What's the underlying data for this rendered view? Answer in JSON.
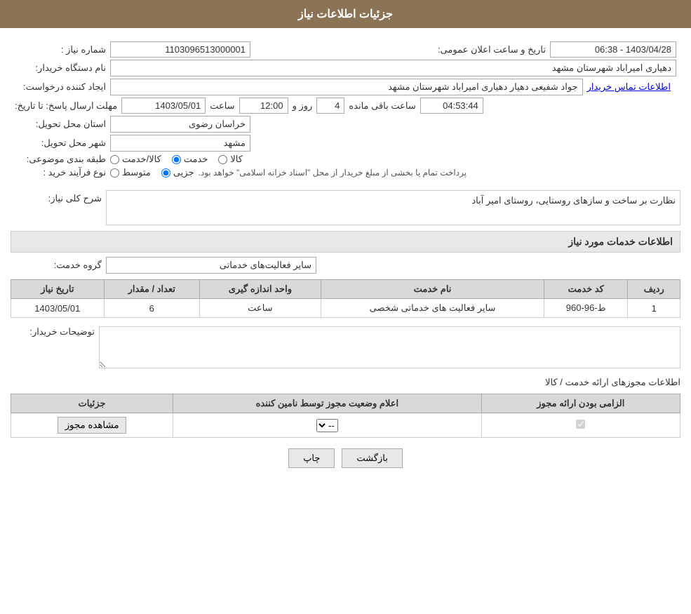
{
  "header": {
    "title": "جزئیات اطلاعات نیاز"
  },
  "fields": {
    "need_number_label": "شماره نیاز :",
    "need_number_value": "1103096513000001",
    "buyer_org_label": "نام دستگاه خریدار:",
    "buyer_org_value": "دهیاری امیراباد شهرستان مشهد",
    "creator_label": "ایجاد کننده درخواست:",
    "creator_value": "جواد شفیعی  دهیار  دهیاری امیراباد شهرستان مشهد",
    "contact_info_link": "اطلاعات تماس خریدار",
    "deadline_label": "مهلت ارسال پاسخ: تا تاریخ:",
    "deadline_date": "1403/05/01",
    "deadline_time_label": "ساعت",
    "deadline_time": "12:00",
    "deadline_days_label": "روز و",
    "deadline_days": "4",
    "deadline_remaining_label": "ساعت باقی مانده",
    "deadline_remaining": "04:53:44",
    "province_label": "استان محل تحویل:",
    "province_value": "خراسان رضوی",
    "city_label": "شهر محل تحویل:",
    "city_value": "مشهد",
    "category_label": "طبقه بندی موضوعی:",
    "category_options": [
      "کالا",
      "خدمت",
      "کالا/خدمت"
    ],
    "category_selected": "خدمت",
    "purchase_type_label": "نوع فرآیند خرید :",
    "purchase_type_options": [
      "جزیی",
      "متوسط"
    ],
    "purchase_type_note": "پرداخت تمام یا بخشی از مبلغ خریدار از محل \"اسناد خزانه اسلامی\" خواهد بود.",
    "need_desc_label": "شرح کلی نیاز:",
    "need_desc_value": "نظارت بر ساخت و سازهای روستایی، روستای امیر آباد",
    "announcement_date_label": "تاریخ و ساعت اعلان عمومی:",
    "announcement_date_value": "1403/04/28 - 06:38"
  },
  "services_section": {
    "title": "اطلاعات خدمات مورد نیاز",
    "service_group_label": "گروه خدمت:",
    "service_group_value": "سایر فعالیت‌های خدماتی",
    "table": {
      "headers": [
        "ردیف",
        "کد خدمت",
        "نام خدمت",
        "واحد اندازه گیری",
        "تعداد / مقدار",
        "تاریخ نیاز"
      ],
      "rows": [
        {
          "row_num": "1",
          "service_code": "ط-96-960",
          "service_name": "سایر فعالیت های خدماتی شخصی",
          "unit": "ساعت",
          "quantity": "6",
          "date": "1403/05/01"
        }
      ]
    }
  },
  "buyer_notes": {
    "label": "توضیحات خریدار:",
    "value": ""
  },
  "permissions_section": {
    "title": "اطلاعات مجوزهای ارائه خدمت / کالا",
    "table": {
      "headers": [
        "الزامی بودن ارائه مجوز",
        "اعلام وضعیت مجوز توسط نامین کننده",
        "جزئیات"
      ],
      "rows": [
        {
          "required": true,
          "status": "--",
          "details_btn": "مشاهده مجوز"
        }
      ]
    }
  },
  "buttons": {
    "print_label": "چاپ",
    "back_label": "بازگشت"
  }
}
